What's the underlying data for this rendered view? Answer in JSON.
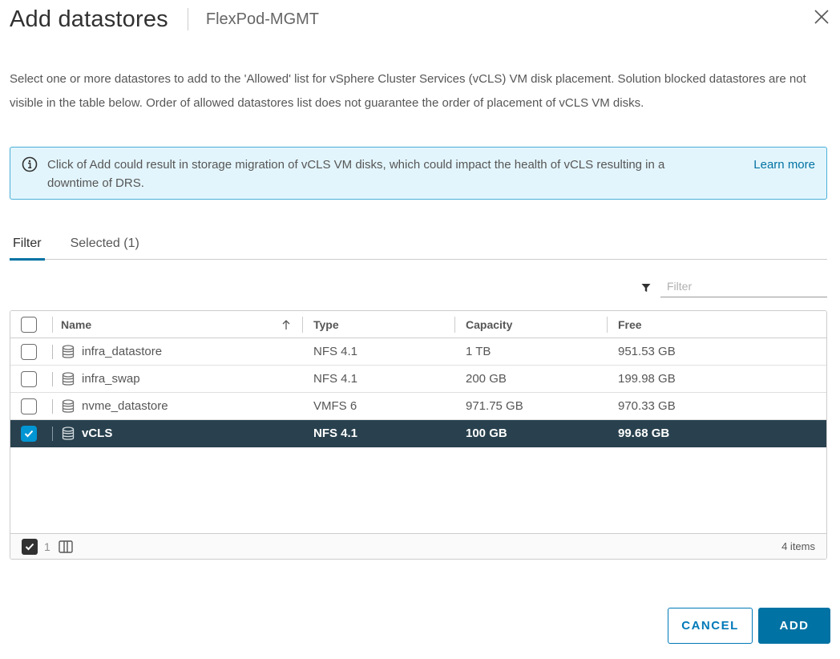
{
  "dialog": {
    "title": "Add datastores",
    "subtitle": "FlexPod-MGMT",
    "close_icon": "close-icon"
  },
  "description": "Select one or more datastores to add to the 'Allowed' list for vSphere Cluster Services (vCLS) VM disk placement. Solution blocked datastores are not visible in the table below. Order of allowed datastores list does not guarantee the order of placement of vCLS VM disks.",
  "alert": {
    "icon": "info-circle-icon",
    "text": "Click of Add could result in storage migration of vCLS VM disks, which could impact the health of vCLS resulting in a downtime of DRS.",
    "link": "Learn more"
  },
  "tabs": [
    {
      "label": "Filter",
      "active": true
    },
    {
      "label": "Selected (1)",
      "active": false
    }
  ],
  "filter": {
    "icon": "filter-icon",
    "placeholder": "Filter",
    "value": ""
  },
  "grid": {
    "columns": [
      "Name",
      "Type",
      "Capacity",
      "Free"
    ],
    "sort": {
      "column": "Name",
      "direction": "ascending",
      "icon": "arrow-up-icon"
    },
    "rows": [
      {
        "name": "infra_datastore",
        "type": "NFS 4.1",
        "capacity": "1 TB",
        "free": "951.53 GB",
        "selected": false
      },
      {
        "name": "infra_swap",
        "type": "NFS 4.1",
        "capacity": "200 GB",
        "free": "199.98 GB",
        "selected": false
      },
      {
        "name": "nvme_datastore",
        "type": "VMFS 6",
        "capacity": "971.75 GB",
        "free": "970.33 GB",
        "selected": false
      },
      {
        "name": "vCLS",
        "type": "NFS 4.1",
        "capacity": "100 GB",
        "free": "99.68 GB",
        "selected": true
      }
    ],
    "footer": {
      "selected_count": "1",
      "items_label": "4 items"
    }
  },
  "buttons": {
    "cancel": "CANCEL",
    "add": "ADD"
  },
  "colors": {
    "primary": "#0072a3",
    "selected_row": "#29414e",
    "checkbox_checked": "#0095d3",
    "alert_bg": "#e3f5fc",
    "alert_border": "#49afd9"
  }
}
